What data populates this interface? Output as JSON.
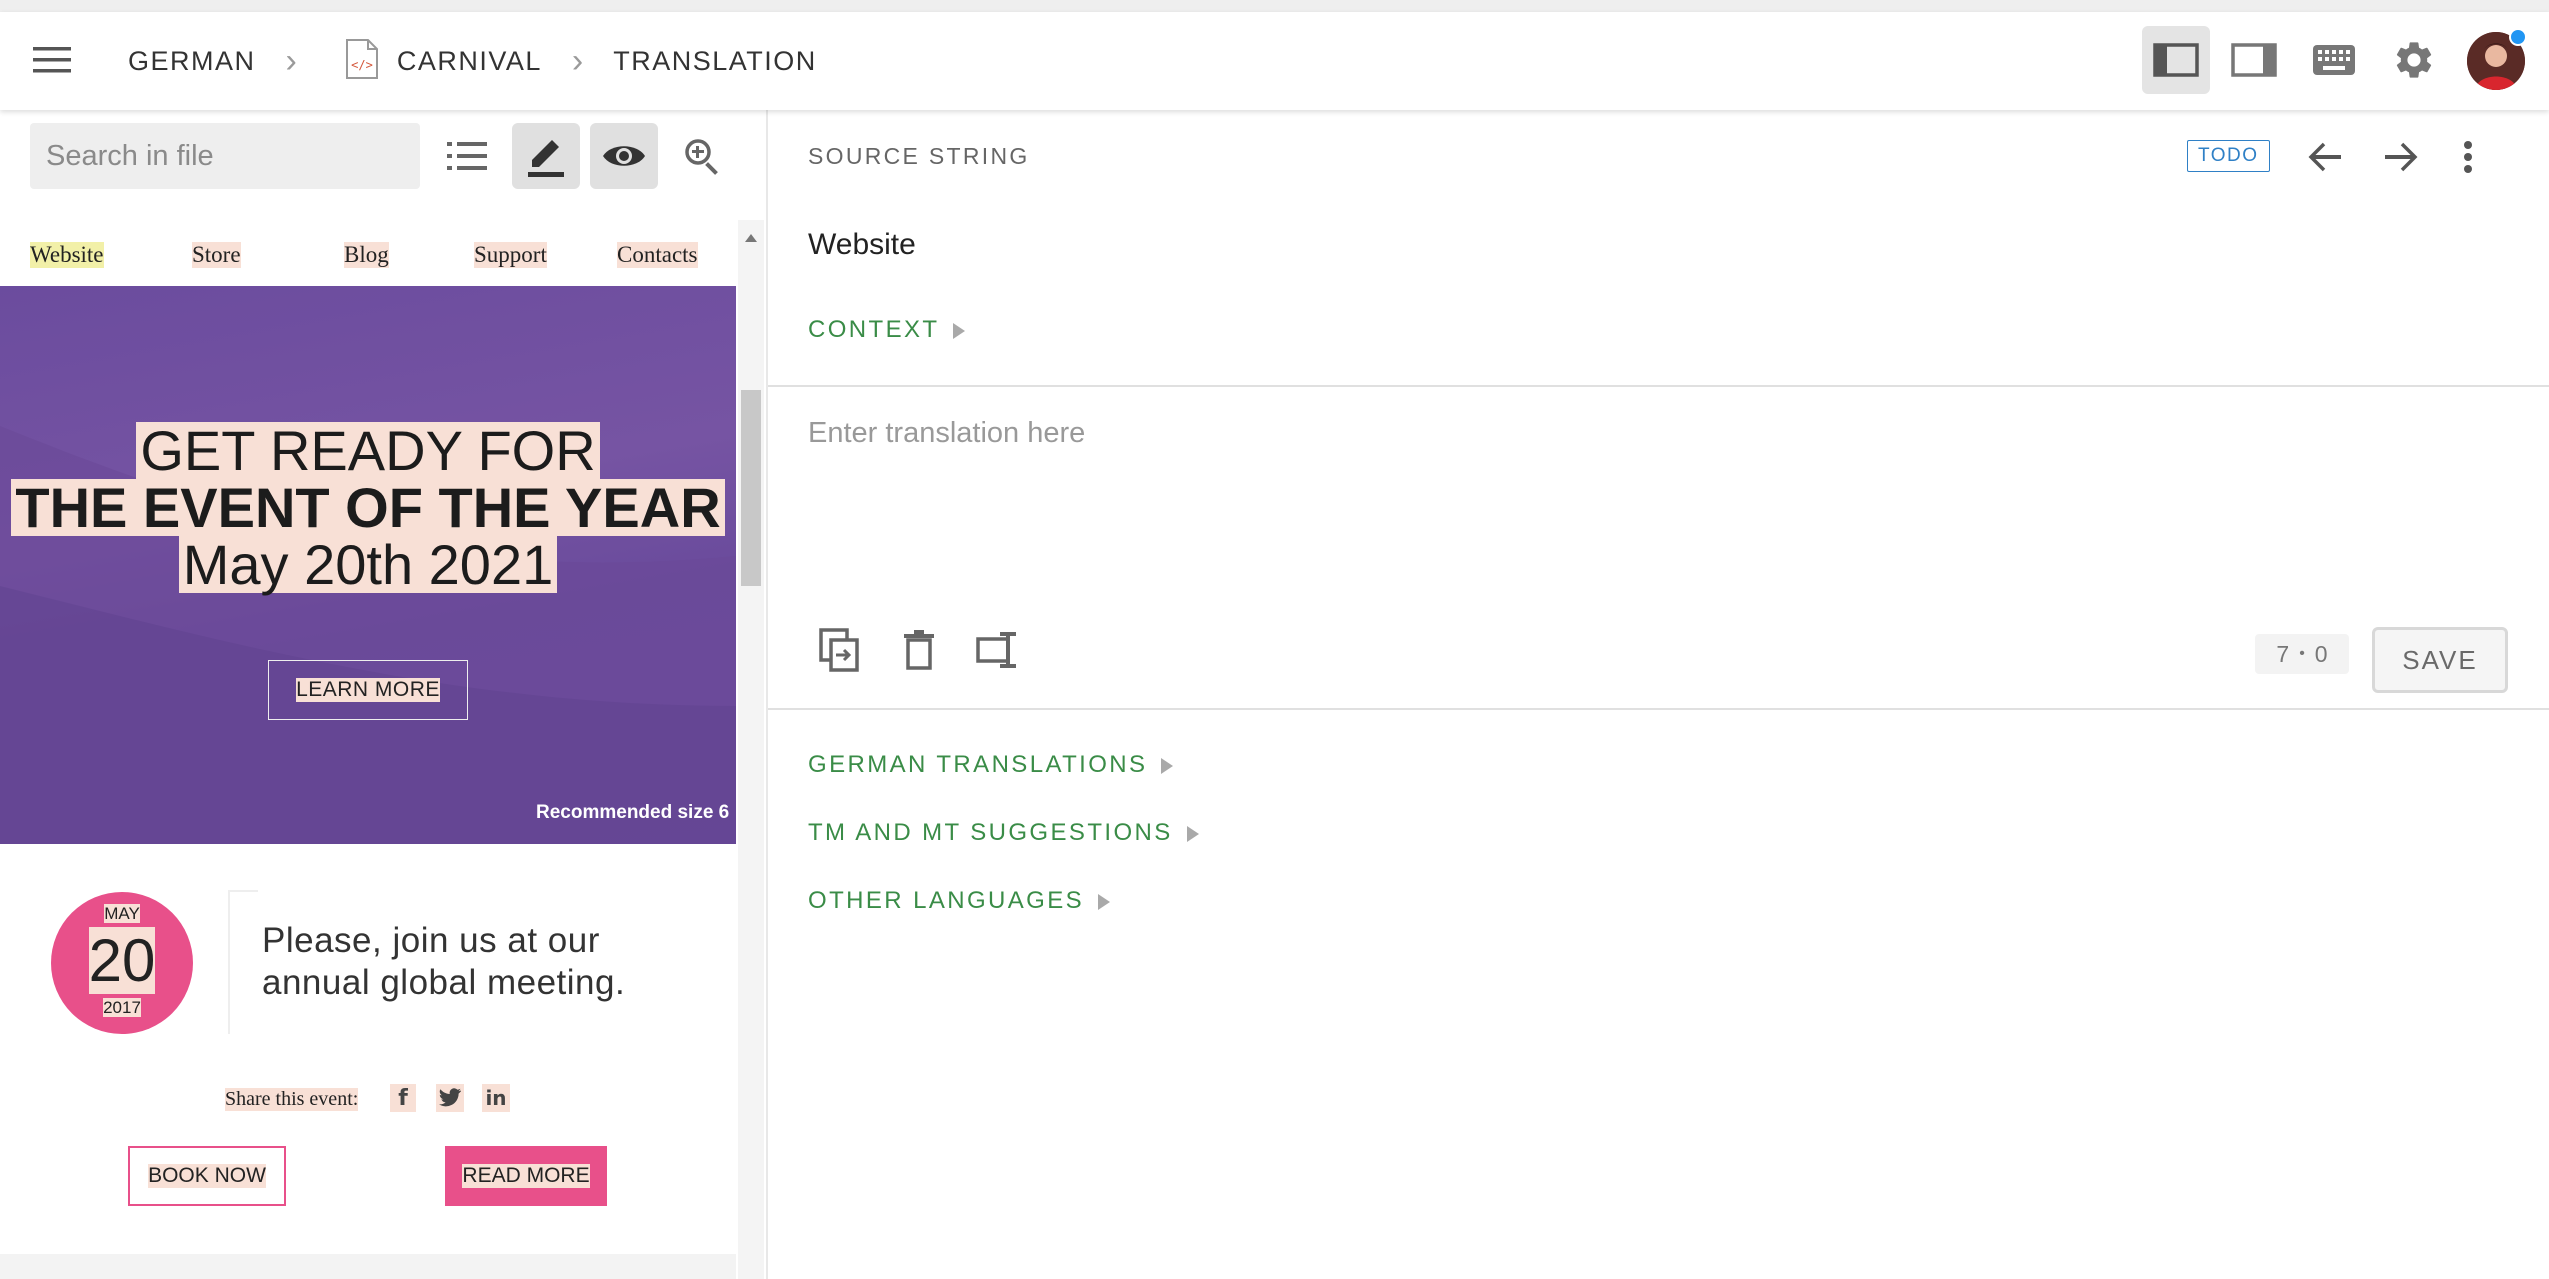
{
  "breadcrumb": {
    "language": "GERMAN",
    "file": "CARNIVAL",
    "section": "TRANSLATION"
  },
  "search": {
    "placeholder": "Search in file"
  },
  "preview": {
    "nav": [
      "Website",
      "Store",
      "Blog",
      "Support",
      "Contacts"
    ],
    "hero": {
      "line1": "GET READY FOR",
      "line2": "THE EVENT OF THE YEAR",
      "line3": "May 20th 2021",
      "button": "LEARN MORE",
      "note": "Recommended size 6"
    },
    "date": {
      "month": "MAY",
      "day": "20",
      "year": "2017"
    },
    "invite": "Please, join us at our annual global meeting.",
    "share_label": "Share this event:",
    "book_button": "BOOK NOW",
    "read_button": "READ MORE"
  },
  "editor": {
    "source_label": "SOURCE STRING",
    "status_badge": "TODO",
    "source_text": "Website",
    "context_label": "CONTEXT",
    "translation_placeholder": "Enter translation here",
    "counter_a": "7",
    "counter_sep": "•",
    "counter_b": "0",
    "save_label": "SAVE",
    "sections": {
      "german_translations": "GERMAN TRANSLATIONS",
      "tm_mt": "TM AND MT SUGGESTIONS",
      "other_languages": "OTHER LANGUAGES"
    }
  },
  "colors": {
    "accent_green": "#3a8c47",
    "todo_blue": "#2f80c6",
    "hero_purple": "#6f4e9e",
    "pink": "#e8508a",
    "highlight": "#f8e0d6"
  }
}
